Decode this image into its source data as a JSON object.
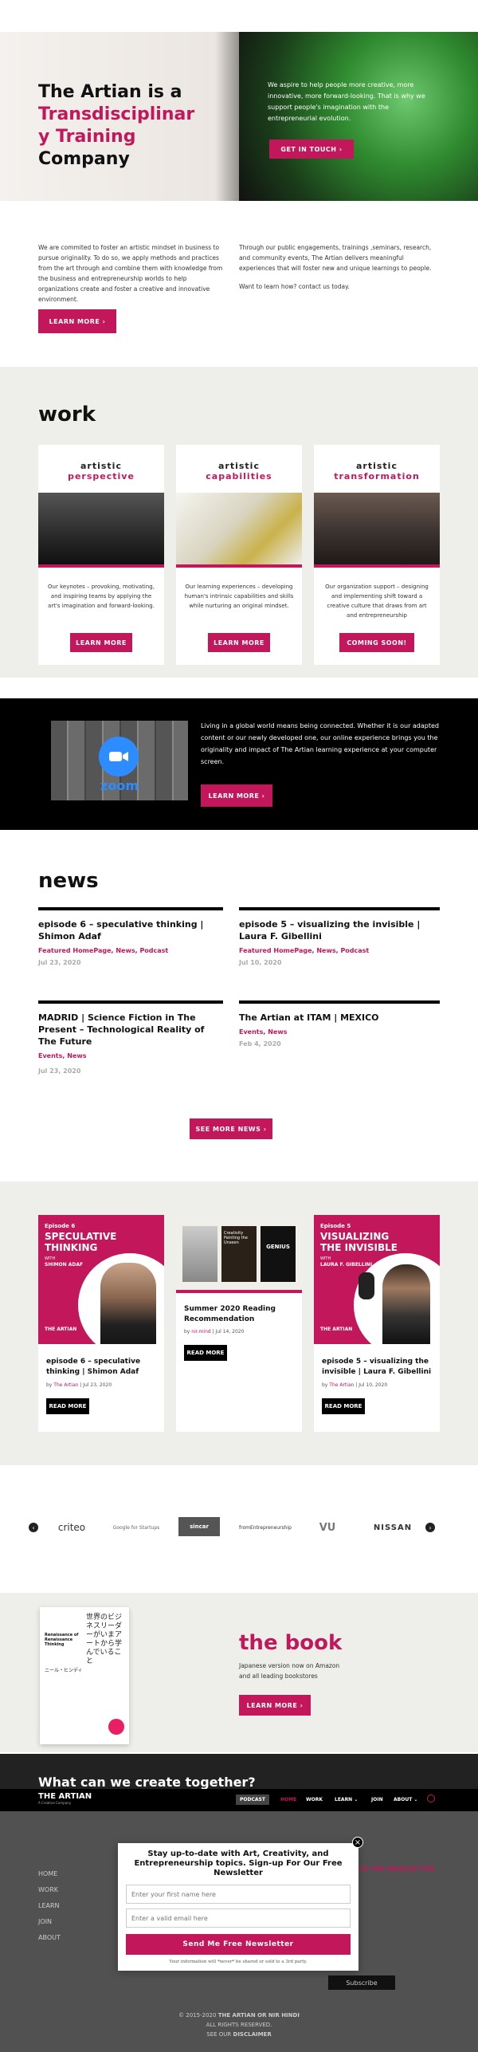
{
  "hero": {
    "title_line1": "The Artian is a",
    "title_line2": "Transdisciplinar",
    "title_line3": "y Training",
    "title_line4": "Company",
    "text": "We aspire to help people more creative, more innovative, more forward-looking. That is why we support people's imagination with the entrepreneurial evolution.",
    "cta": "GET IN TOUCH"
  },
  "intro": {
    "left": "We are commited to foster an artistic mindset in business to pursue originality. To do so, we apply methods and practices from the art through and combine them with knowledge from the business and entrepreneurship worlds to help organizations create and foster a creative and innovative environment.",
    "right": "Through our public engagements, trainings ,seminars, research, and community events, The Artian delivers meaningful experiences that will foster new and unique learnings to people.",
    "right2": "Want to learn how? contact us today.",
    "cta": "LEARN MORE"
  },
  "work": {
    "title": "work",
    "cards": [
      {
        "t1": "artistic",
        "t2": "perspective",
        "desc": "Our keynotes – provoking, motivating, and inspiring teams by applying the art's imagination and forward-looking.",
        "btn": "LEARN MORE"
      },
      {
        "t1": "artistic",
        "t2": "capabilities",
        "desc": "Our learning experiences – developing human's intrinsic capabilities and skills while nurturing an original mindset.",
        "btn": "LEARN MORE"
      },
      {
        "t1": "artistic",
        "t2": "transformation",
        "desc": "Our organization support – designing and implementing shift toward a creative culture that draws from art and entrepreneurship",
        "btn": "COMING SOON!"
      }
    ]
  },
  "online": {
    "text": "Living in a global world means being connected. Whether it is our adapted content or our newly developed one, our online experience brings you the originality and impact of The Artian learning experience at your computer screen.",
    "btn": "LEARN MORE",
    "zoom": "zoom"
  },
  "news": {
    "title": "news",
    "items": [
      {
        "title": "episode 6 – speculative thinking | Shimon Adaf",
        "cats": "Featured HomePage, News, Podcast",
        "date": "Jul 23, 2020"
      },
      {
        "title": "episode 5 – visualizing the invisible | Laura F. Gibellini",
        "cats": "Featured HomePage, News, Podcast",
        "date": "Jul 10, 2020"
      },
      {
        "title": "MADRID | Science Fiction in The Present – Technological Reality of The Future",
        "cats": "Events, News",
        "date": "Jul 23, 2020"
      },
      {
        "title": "The Artian at ITAM | MEXICO",
        "cats": "Events, News",
        "date": "Feb 4, 2020"
      }
    ],
    "btn": "SEE MORE NEWS"
  },
  "posts": [
    {
      "ep": "Episode 6",
      "big": "SPECULATIVE THINKING",
      "with": "WITH",
      "who": "SHIMON ADAF",
      "brand": "THE ARTIAN",
      "title": "episode 6 – speculative thinking | Shimon Adaf",
      "meta_by": "by",
      "author": "The Artian",
      "date": "Jul 23, 2020",
      "btn": "READ MORE"
    },
    {
      "title": "Summer 2020 Reading Recommendation",
      "meta_by": "by",
      "author": "nir.mind",
      "date": "Jul 14, 2020",
      "btn": "READ MORE",
      "book_title": "Creativity Painting the Unseen",
      "book3": "GENIUS"
    },
    {
      "ep": "Episode 5",
      "big": "VISUALIZING THE INVISIBLE",
      "with": "WITH",
      "who": "LAURA F. GIBELLINI",
      "brand": "THE ARTIAN",
      "title": "episode 5 – visualizing the invisible | Laura F. Gibellini",
      "meta_by": "by",
      "author": "The Artian",
      "date": "Jul 10, 2020",
      "btn": "READ MORE"
    }
  ],
  "clients": [
    "criteo",
    "Google for Startups",
    "sincar",
    "fromEntrepreneurship",
    "VU",
    "NISSAN"
  ],
  "book": {
    "title": "the book",
    "line1": "Japanese version now on Amazon",
    "line2": "and all leading bookstores",
    "btn": "LEARN MORE",
    "cover_title": "Renaissance of Renaissance Thinking",
    "cover_jp": "世界のビジネスリーダーがいまアートから学んでいること",
    "cover_author": "ニール・ヒンディ"
  },
  "footer": {
    "headline": "What can we create together?",
    "logo": "THE ARTIAN",
    "logo_sub": "A Creative Company",
    "nav": [
      "PODCAST",
      "HOME",
      "WORK",
      "LEARN",
      "JOIN",
      "ABOUT"
    ],
    "links": [
      "HOME",
      "WORK",
      "LEARN",
      "JOIN",
      "ABOUT"
    ],
    "newsletter_label": "TO THE NEWSLETTER",
    "subscribe": "Subscribe",
    "copy1": "© 2015-2020",
    "copy1b": "THE ARTIAN OR NIR HINDI",
    "copy2": "ALL RIGHTS RESERVED.",
    "copy3": "SEE OUR",
    "copy3b": "DISCLAIMER"
  },
  "popup": {
    "close": "×",
    "title": "Stay up-to-date with Art, Creativity, and Entrepreneurship topics. Sign-up For Our Free Newsletter",
    "name_ph": "Enter your first name here",
    "email_ph": "Enter a valid email here",
    "btn": "Send Me Free Newsletter",
    "note": "Your information will *never* be shared or sold to a 3rd party."
  },
  "colors": {
    "accent": "#c2185b",
    "dark": "#000000",
    "grey": "#eeeeea"
  }
}
